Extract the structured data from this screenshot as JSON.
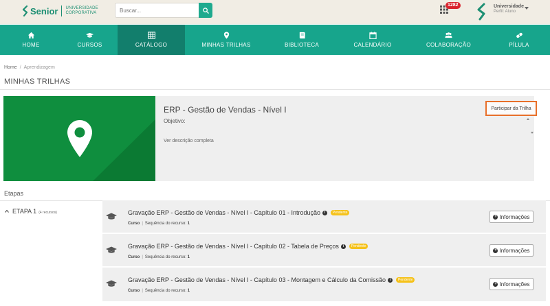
{
  "header": {
    "logo_name": "Senior",
    "logo_sub_line1": "UNIVERSIDADE",
    "logo_sub_line2": "CORPORATIVA",
    "search_placeholder": "Buscar...",
    "notification_count": "1282",
    "user_name": "Universidade",
    "user_profile": "Perfil: Aluno",
    "brand_color": "#17a58c"
  },
  "nav": {
    "items": [
      {
        "label": "HOME",
        "icon": "home-icon"
      },
      {
        "label": "CURSOS",
        "icon": "graduation-cap-icon"
      },
      {
        "label": "CATÁLOGO",
        "icon": "grid-icon"
      },
      {
        "label": "MINHAS TRILHAS",
        "icon": "map-marker-icon"
      },
      {
        "label": "BIBLIOTECA",
        "icon": "book-icon"
      },
      {
        "label": "CALENDÁRIO",
        "icon": "calendar-icon"
      },
      {
        "label": "COLABORAÇÃO",
        "icon": "users-icon"
      },
      {
        "label": "PÍLULA",
        "icon": "pill-icon"
      }
    ],
    "active": "CATÁLOGO"
  },
  "breadcrumb": {
    "home": "Home",
    "separator": "/",
    "current": "Aprendizagem"
  },
  "page_title": "MINHAS TRILHAS",
  "trail": {
    "title": "ERP - Gestão de Vendas - Nível I",
    "objective_label": "Objetivo:",
    "more_link": "Ver descrição completa",
    "join_button": "Participar da Trilha"
  },
  "stages": {
    "title": "Etapas",
    "stage_name": "ETAPA 1",
    "stage_count": "(4 recursos)",
    "resources": [
      {
        "title": "Gravação ERP - Gestão de Vendas - Nível I - Capítulo 01 - Introdução",
        "status": "Pendente",
        "type": "Curso",
        "sequence_label": "Sequência do recurso:",
        "sequence": "1",
        "button": "Informações"
      },
      {
        "title": "Gravação ERP - Gestão de Vendas - Nível I - Capítulo 02 - Tabela de Preços",
        "status": "Pendente",
        "type": "Curso",
        "sequence_label": "Sequência do recurso:",
        "sequence": "1",
        "button": "Informações"
      },
      {
        "title": "Gravação ERP - Gestão de Vendas - Nível I - Capítulo 03 - Montagem e Cálculo da Comissão",
        "status": "Pendente",
        "type": "Curso",
        "sequence_label": "Sequência do recurso:",
        "sequence": "1",
        "button": "Informações"
      }
    ]
  }
}
